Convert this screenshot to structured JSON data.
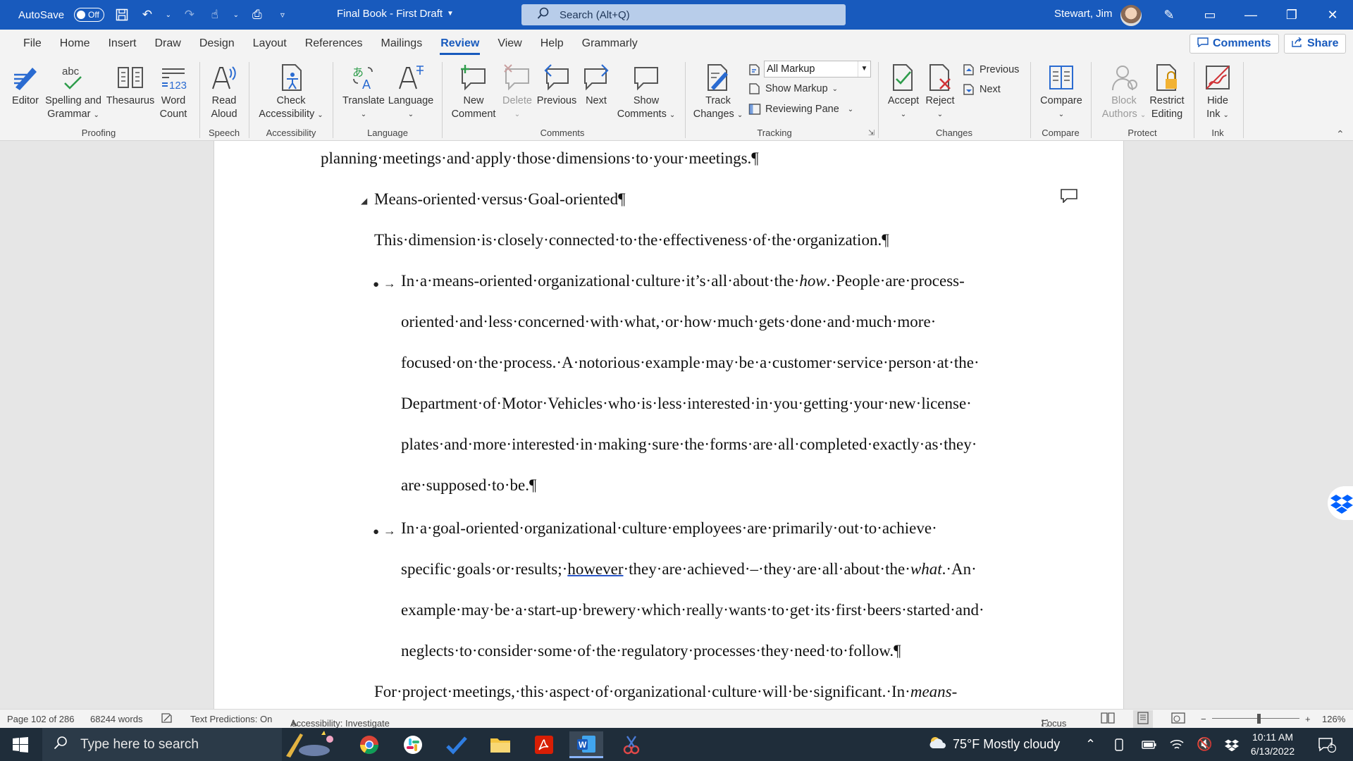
{
  "titlebar": {
    "autosave_label": "AutoSave",
    "autosave_state": "Off",
    "doc_title": "Final Book - First Draft",
    "search_placeholder": "Search (Alt+Q)",
    "user_name": "Stewart, Jim",
    "accent_color": "#185abd"
  },
  "menu": {
    "tabs": [
      "File",
      "Home",
      "Insert",
      "Draw",
      "Design",
      "Layout",
      "References",
      "Mailings",
      "Review",
      "View",
      "Help",
      "Grammarly"
    ],
    "active_tab": "Review",
    "comments_label": "Comments",
    "share_label": "Share"
  },
  "ribbon": {
    "proofing": {
      "editor": "Editor",
      "spelling_1": "Spelling and",
      "spelling_2": "Grammar",
      "thesaurus": "Thesaurus",
      "word_count_1": "Word",
      "word_count_2": "Count",
      "label": "Proofing"
    },
    "speech": {
      "read_1": "Read",
      "read_2": "Aloud",
      "label": "Speech"
    },
    "accessibility": {
      "check_1": "Check",
      "check_2": "Accessibility",
      "label": "Accessibility"
    },
    "language": {
      "translate": "Translate",
      "language": "Language",
      "label": "Language"
    },
    "comments": {
      "new_1": "New",
      "new_2": "Comment",
      "delete": "Delete",
      "previous": "Previous",
      "next": "Next",
      "show_1": "Show",
      "show_2": "Comments",
      "label": "Comments"
    },
    "tracking": {
      "track_1": "Track",
      "track_2": "Changes",
      "markup_select": "All Markup",
      "show_markup": "Show Markup",
      "reviewing_pane": "Reviewing Pane",
      "label": "Tracking"
    },
    "changes": {
      "accept": "Accept",
      "reject": "Reject",
      "previous": "Previous",
      "next": "Next",
      "label": "Changes"
    },
    "compare": {
      "compare": "Compare",
      "label": "Compare"
    },
    "protect": {
      "block_1": "Block",
      "block_2": "Authors",
      "restrict_1": "Restrict",
      "restrict_2": "Editing",
      "label": "Protect"
    },
    "ink": {
      "hide_1": "Hide",
      "hide_2": "Ink",
      "label": "Ink"
    }
  },
  "document": {
    "line0": "planning·meetings·and·apply·those·dimensions·to·your·meetings.¶",
    "heading": "Means-oriented·versus·Goal-oriented¶",
    "intro": "This·dimension·is·closely·connected·to·the·effectiveness·of·the·organization.¶",
    "b1_l1_a": "In·a·means-oriented·organizational·culture·it’s·all·about·the·",
    "b1_l1_em": "how",
    "b1_l1_b": ".·People·are·process-",
    "b1_l2": "oriented·and·less·concerned·with·what,·or·how·much·gets·done·and·much·more·",
    "b1_l3": "focused·on·the·process.·A·notorious·example·may·be·a·customer·service·person·at·the·",
    "b1_l4": "Department·of·Motor·Vehicles·who·is·less·interested·in·you·getting·your·new·license·",
    "b1_l5": "plates·and·more·interested·in·making·sure·the·forms·are·all·completed·exactly·as·they·",
    "b1_l6": "are·supposed·to·be.¶",
    "b2_l1": "In·a·goal-oriented·organizational·culture·employees·are·primarily·out·to·achieve·",
    "b2_l2_a": "specific·goals·or·results;·",
    "b2_l2_flag": "however",
    "b2_l2_b": "·they·are·achieved·–·they·are·all·about·the·",
    "b2_l2_em": "what",
    "b2_l2_c": ".·An·",
    "b2_l3": "example·may·be·a·start-up·brewery·which·really·wants·to·get·its·first·beers·started·and·",
    "b2_l4": "neglects·to·consider·some·of·the·regulatory·processes·they·need·to·follow.¶",
    "last_a": "For·project·meetings,·this·aspect·of·organizational·culture·will·be·significant.·In·",
    "last_em": "means-",
    "bullet_marker": "●",
    "tab_arrow": "→"
  },
  "statusbar": {
    "page": "Page 102 of 286",
    "words": "68244 words",
    "predictions": "Text Predictions: On",
    "accessibility": "Accessibility: Investigate",
    "focus": "Focus",
    "zoom": "126%"
  },
  "taskbar": {
    "search_placeholder": "Type here to search",
    "weather": "75°F  Mostly cloudy",
    "time": "10:11 AM",
    "date": "6/13/2022",
    "notification_count": "1"
  }
}
